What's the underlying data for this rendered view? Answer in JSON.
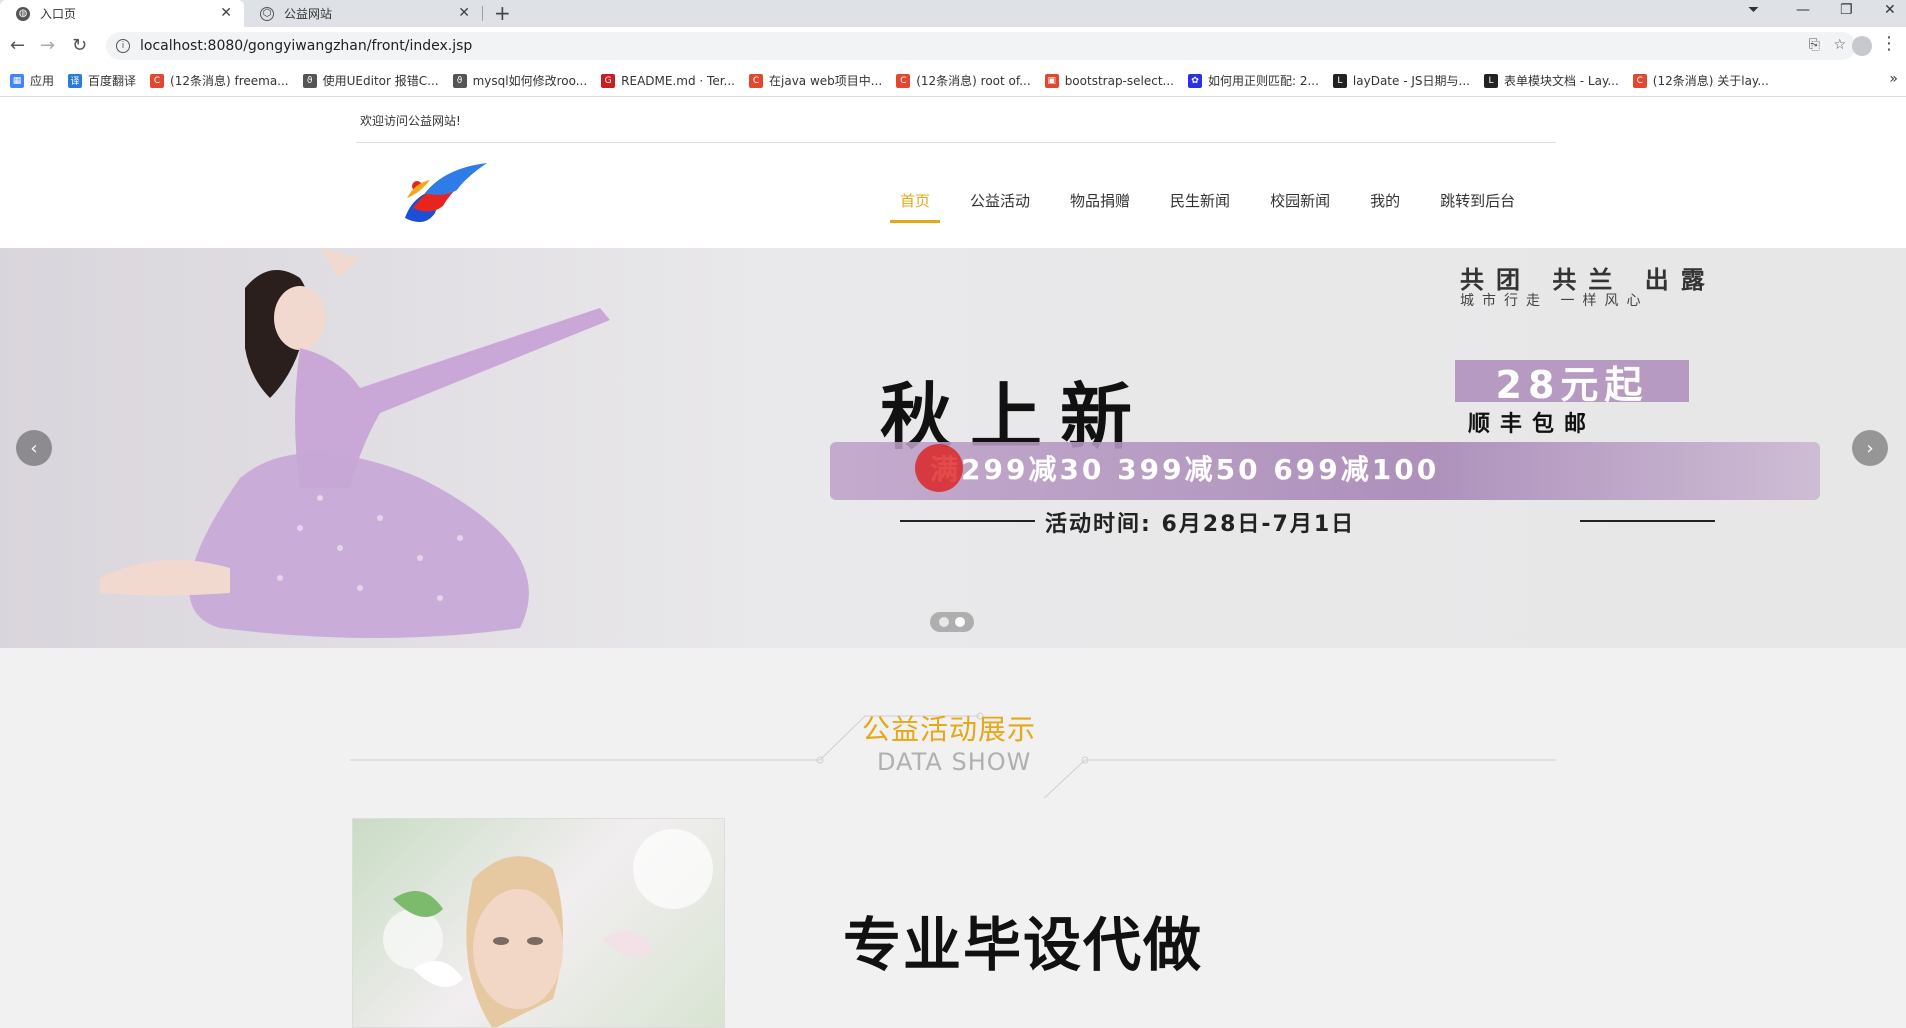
{
  "browser": {
    "tabs": [
      {
        "title": "入口页",
        "active": true
      },
      {
        "title": "公益网站",
        "active": false
      }
    ],
    "url": "localhost:8080/gongyiwangzhan/front/index.jsp",
    "bookmarks": [
      {
        "label": "应用",
        "icon": "apps-icon",
        "color": "#4285f4"
      },
      {
        "label": "百度翻译",
        "icon": "translate-icon",
        "color": "#2b7bd8"
      },
      {
        "label": "(12条消息) freema...",
        "icon": "csdn-icon",
        "color": "#e2472f"
      },
      {
        "label": "使用UEditor 报错C...",
        "icon": "leaf-icon",
        "color": "#555555"
      },
      {
        "label": "mysql如何修改roo...",
        "icon": "leaf-icon",
        "color": "#555555"
      },
      {
        "label": "README.md · Ter...",
        "icon": "gitee-icon",
        "color": "#c71d23"
      },
      {
        "label": "在java web项目中...",
        "icon": "csdn-icon",
        "color": "#e2472f"
      },
      {
        "label": "(12条消息) root of...",
        "icon": "csdn-icon",
        "color": "#e2472f"
      },
      {
        "label": "bootstrap-select...",
        "icon": "doc-icon",
        "color": "#e2472f"
      },
      {
        "label": "如何用正则匹配: 2...",
        "icon": "baidu-icon",
        "color": "#2932e1"
      },
      {
        "label": "layDate - JS日期与...",
        "icon": "layui-icon",
        "color": "#222222"
      },
      {
        "label": "表单模块文档 - Lay...",
        "icon": "layui-icon",
        "color": "#222222"
      },
      {
        "label": "(12条消息) 关于lay...",
        "icon": "csdn-icon",
        "color": "#e2472f"
      }
    ]
  },
  "site": {
    "welcome": "欢迎访问公益网站!",
    "nav": [
      {
        "label": "首页",
        "active": true
      },
      {
        "label": "公益活动",
        "active": false
      },
      {
        "label": "物品捐赠",
        "active": false
      },
      {
        "label": "民生新闻",
        "active": false
      },
      {
        "label": "校园新闻",
        "active": false
      },
      {
        "label": "我的",
        "active": false
      },
      {
        "label": "跳转到后台",
        "active": false
      }
    ],
    "banner": {
      "top_tags": "共团 共兰 出露",
      "top_tags_sub": "城市行走 一样风心",
      "title": "秋上新",
      "price": "28元起",
      "shipping": "顺丰包邮",
      "offer": "满299减30  399减50  699减100",
      "time": "活动时间: 6月28日-7月1日",
      "prev_arrow": "‹",
      "next_arrow": "›",
      "slides": 2,
      "current_slide": 2
    },
    "section": {
      "title": "公益活动展示",
      "subtitle": "DATA SHOW",
      "ad_text": "专业毕设代做"
    }
  },
  "colors": {
    "accent": "#e6a817",
    "tabbar": "#dee1e6"
  }
}
